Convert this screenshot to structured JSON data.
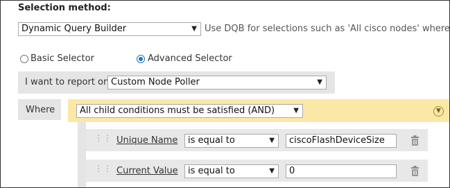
{
  "selection": {
    "title": "Selection method:",
    "method_value": "Dynamic Query Builder",
    "method_hint": "Use DQB for selections such as 'All cisco nodes' where"
  },
  "selector_mode": {
    "basic_label": "Basic Selector",
    "advanced_label": "Advanced Selector",
    "selected": "Advanced Selector"
  },
  "report": {
    "label": "I want to report on",
    "value": "Custom Node Poller"
  },
  "where": {
    "label": "Where",
    "condition_value": "All child conditions must be satisfied (AND)",
    "collapse_icon": "chevron-down-circle-icon",
    "accent_color": "#fbe8a6"
  },
  "conditions": [
    {
      "field": "Unique Name",
      "operator": "is equal to",
      "value": "ciscoFlashDeviceSize"
    },
    {
      "field": "Current Value",
      "operator": "is equal to",
      "value": "0"
    }
  ]
}
